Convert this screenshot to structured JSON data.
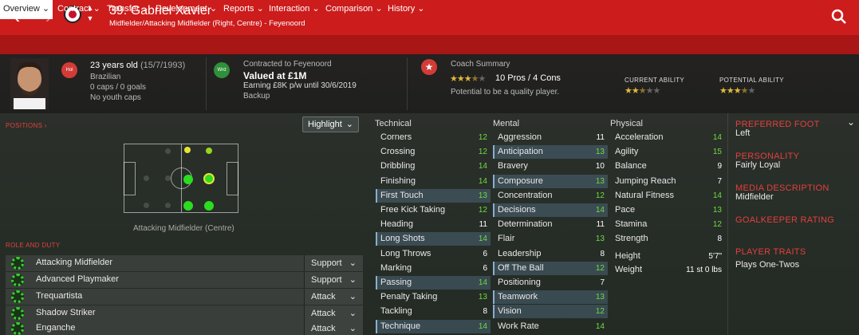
{
  "header": {
    "back_label": "‹",
    "forward_label": "›",
    "title": "39. Gabriel Xavier",
    "subtitle": "Midfielder/Attacking Midfielder (Right, Centre) - Feyenoord"
  },
  "tabs": [
    {
      "label": "Overview ⌄",
      "active": true
    },
    {
      "label": "Contract ⌄"
    },
    {
      "label": "Transfer ⌄"
    },
    {
      "label": "Development ⌄"
    },
    {
      "label": "Reports ⌄"
    },
    {
      "label": "Interaction ⌄"
    },
    {
      "label": "Comparison ⌄"
    },
    {
      "label": "History ⌄"
    }
  ],
  "profile": {
    "age": "23 years old",
    "dob": "(15/7/1993)",
    "nationality": "Brazilian",
    "caps": "0 caps / 0 goals",
    "youth": "No youth caps",
    "badge1": "Hol",
    "badge2": "Wrd"
  },
  "contract": {
    "to": "Contracted to Feyenoord",
    "value": "Valued at £1M",
    "earning": "Earning £8K p/w until 30/6/2019",
    "status": "Backup"
  },
  "coach": {
    "title": "Coach Summary",
    "pros_cons": "10 Pros / 4 Cons",
    "summary": "Potential to be a quality player.",
    "rating": 3.5,
    "current_label": "CURRENT ABILITY",
    "current_stars": 2.5,
    "potential_label": "POTENTIAL ABILITY",
    "potential_stars": 3.5
  },
  "positions": {
    "label": "POSITIONS ›",
    "highlight_label": "Highlight",
    "role_caption": "Attacking Midfielder (Centre)"
  },
  "roles": {
    "label": "ROLE AND DUTY",
    "items": [
      {
        "name": "Attacking Midfielder",
        "duty": "Support"
      },
      {
        "name": "Advanced Playmaker",
        "duty": "Support"
      },
      {
        "name": "Trequartista",
        "duty": "Attack"
      },
      {
        "name": "Shadow Striker",
        "duty": "Attack"
      },
      {
        "name": "Enganche",
        "duty": "Attack"
      }
    ]
  },
  "attributes": {
    "technical_label": "Technical",
    "mental_label": "Mental",
    "physical_label": "Physical",
    "technical": [
      {
        "name": "Corners",
        "value": "12",
        "hl": false
      },
      {
        "name": "Crossing",
        "value": "12",
        "hl": false
      },
      {
        "name": "Dribbling",
        "value": "14",
        "hl": false
      },
      {
        "name": "Finishing",
        "value": "14",
        "hl": false
      },
      {
        "name": "First Touch",
        "value": "13",
        "hl": true
      },
      {
        "name": "Free Kick Taking",
        "value": "12",
        "hl": false
      },
      {
        "name": "Heading",
        "value": "11",
        "hl": false
      },
      {
        "name": "Long Shots",
        "value": "14",
        "hl": true
      },
      {
        "name": "Long Throws",
        "value": "6",
        "hl": false
      },
      {
        "name": "Marking",
        "value": "6",
        "hl": false
      },
      {
        "name": "Passing",
        "value": "14",
        "hl": true
      },
      {
        "name": "Penalty Taking",
        "value": "13",
        "hl": false
      },
      {
        "name": "Tackling",
        "value": "8",
        "hl": false
      },
      {
        "name": "Technique",
        "value": "14",
        "hl": true
      }
    ],
    "mental": [
      {
        "name": "Aggression",
        "value": "11",
        "hl": false
      },
      {
        "name": "Anticipation",
        "value": "13",
        "hl": true
      },
      {
        "name": "Bravery",
        "value": "10",
        "hl": false
      },
      {
        "name": "Composure",
        "value": "13",
        "hl": true
      },
      {
        "name": "Concentration",
        "value": "12",
        "hl": false
      },
      {
        "name": "Decisions",
        "value": "14",
        "hl": true
      },
      {
        "name": "Determination",
        "value": "11",
        "hl": false
      },
      {
        "name": "Flair",
        "value": "13",
        "hl": false
      },
      {
        "name": "Leadership",
        "value": "8",
        "hl": false
      },
      {
        "name": "Off The Ball",
        "value": "12",
        "hl": true
      },
      {
        "name": "Positioning",
        "value": "7",
        "hl": false
      },
      {
        "name": "Teamwork",
        "value": "13",
        "hl": true
      },
      {
        "name": "Vision",
        "value": "12",
        "hl": true
      },
      {
        "name": "Work Rate",
        "value": "14",
        "hl": false
      }
    ],
    "physical": [
      {
        "name": "Acceleration",
        "value": "14"
      },
      {
        "name": "Agility",
        "value": "15"
      },
      {
        "name": "Balance",
        "value": "9"
      },
      {
        "name": "Jumping Reach",
        "value": "7"
      },
      {
        "name": "Natural Fitness",
        "value": "14"
      },
      {
        "name": "Pace",
        "value": "13"
      },
      {
        "name": "Stamina",
        "value": "12"
      },
      {
        "name": "Strength",
        "value": "8"
      }
    ],
    "height_label": "Height",
    "height": "5'7\"",
    "weight_label": "Weight",
    "weight": "11 st 0 lbs"
  },
  "right_panel": {
    "foot_label": "PREFERRED FOOT",
    "foot": "Left",
    "personality_label": "PERSONALITY",
    "personality": "Fairly Loyal",
    "media_label": "MEDIA DESCRIPTION",
    "media": "Midfielder",
    "gk_label": "GOALKEEPER RATING",
    "traits_label": "PLAYER TRAITS",
    "traits": "Plays One-Twos"
  },
  "colors": {
    "accent": "#cc1c1c",
    "value_green": "#6edb45",
    "star": "#e2b93b"
  }
}
